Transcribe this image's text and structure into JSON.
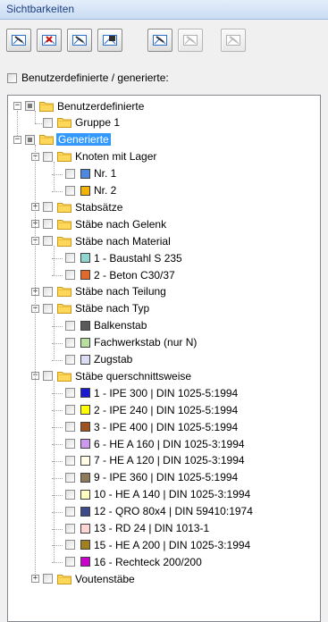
{
  "panel": {
    "title": "Sichtbarkeiten"
  },
  "toolbar": {
    "buttons": [
      {
        "icon": "show-selected-icon",
        "enabled": true
      },
      {
        "icon": "hide-selected-icon",
        "enabled": true
      },
      {
        "icon": "show-all-icon",
        "enabled": true
      },
      {
        "icon": "invert-visibility-icon",
        "enabled": true
      },
      {
        "icon": "show-user-defined-icon",
        "enabled": true
      },
      {
        "icon": "hide-user-defined-icon",
        "enabled": false
      },
      {
        "icon": "reset-visibility-icon",
        "enabled": false
      }
    ]
  },
  "filter": {
    "label": "Benutzerdefinierte / generierte:"
  },
  "tree": [
    {
      "label": "Benutzerdefinierte",
      "kind": "folder",
      "level": 0,
      "expander": "−",
      "check": "part"
    },
    {
      "label": "Gruppe 1",
      "kind": "folder",
      "level": 1,
      "expander": "",
      "check": "off"
    },
    {
      "label": "Generierte",
      "kind": "folder",
      "level": 0,
      "expander": "−",
      "check": "part",
      "selected": true
    },
    {
      "label": "Knoten mit Lager",
      "kind": "folder",
      "level": 1,
      "expander": "−",
      "check": "off"
    },
    {
      "label": "Nr. 1",
      "kind": "item",
      "level": 2,
      "color": "#4d88e0",
      "check": "off"
    },
    {
      "label": "Nr. 2",
      "kind": "item",
      "level": 2,
      "color": "#f2b400",
      "check": "off"
    },
    {
      "label": "Stabsätze",
      "kind": "folder",
      "level": 1,
      "expander": "+",
      "check": "off"
    },
    {
      "label": "Stäbe nach Gelenk",
      "kind": "folder",
      "level": 1,
      "expander": "+",
      "check": "off"
    },
    {
      "label": "Stäbe nach Material",
      "kind": "folder",
      "level": 1,
      "expander": "−",
      "check": "off"
    },
    {
      "label": "1 - Baustahl S 235",
      "kind": "item",
      "level": 2,
      "color": "#8fd6d0",
      "check": "off"
    },
    {
      "label": "2 - Beton C30/37",
      "kind": "item",
      "level": 2,
      "color": "#e0692c",
      "check": "off"
    },
    {
      "label": "Stäbe nach Teilung",
      "kind": "folder",
      "level": 1,
      "expander": "+",
      "check": "off"
    },
    {
      "label": "Stäbe nach Typ",
      "kind": "folder",
      "level": 1,
      "expander": "−",
      "check": "off"
    },
    {
      "label": "Balkenstab",
      "kind": "item",
      "level": 2,
      "color": "#5a5a5a",
      "check": "off"
    },
    {
      "label": "Fachwerkstab (nur N)",
      "kind": "item",
      "level": 2,
      "color": "#b8dfa0",
      "check": "off"
    },
    {
      "label": "Zugstab",
      "kind": "item",
      "level": 2,
      "color": "#dcdcf4",
      "check": "off"
    },
    {
      "label": "Stäbe querschnittsweise",
      "kind": "folder",
      "level": 1,
      "expander": "−",
      "check": "off"
    },
    {
      "label": "1 - IPE 300 | DIN 1025-5:1994",
      "kind": "item",
      "level": 2,
      "color": "#1a1ad0",
      "check": "off"
    },
    {
      "label": "2 - IPE 240 | DIN 1025-5:1994",
      "kind": "item",
      "level": 2,
      "color": "#ffff00",
      "check": "off"
    },
    {
      "label": "3 - IPE 400 | DIN 1025-5:1994",
      "kind": "item",
      "level": 2,
      "color": "#a0521e",
      "check": "off"
    },
    {
      "label": "6 - HE A 160 | DIN 1025-3:1994",
      "kind": "item",
      "level": 2,
      "color": "#cc99ee",
      "check": "off"
    },
    {
      "label": "7 - HE A 120 | DIN 1025-3:1994",
      "kind": "item",
      "level": 2,
      "color": "#fffbe6",
      "check": "off"
    },
    {
      "label": "9 - IPE 360 | DIN 1025-5:1994",
      "kind": "item",
      "level": 2,
      "color": "#8c7a5a",
      "check": "off"
    },
    {
      "label": "10 - HE A 140 | DIN 1025-3:1994",
      "kind": "item",
      "level": 2,
      "color": "#ffffc0",
      "check": "off"
    },
    {
      "label": "12 - QRO 80x4 | DIN 59410:1974",
      "kind": "item",
      "level": 2,
      "color": "#3d4a8a",
      "check": "off"
    },
    {
      "label": "13 - RD 24 | DIN 1013-1",
      "kind": "item",
      "level": 2,
      "color": "#ffd6d6",
      "check": "off"
    },
    {
      "label": "15 - HE A 200 | DIN 1025-3:1994",
      "kind": "item",
      "level": 2,
      "color": "#a08020",
      "check": "off"
    },
    {
      "label": "16 - Rechteck 200/200",
      "kind": "item",
      "level": 2,
      "color": "#cc00cc",
      "check": "off"
    },
    {
      "label": "Voutenstäbe",
      "kind": "folder",
      "level": 1,
      "expander": "+",
      "check": "off"
    }
  ]
}
